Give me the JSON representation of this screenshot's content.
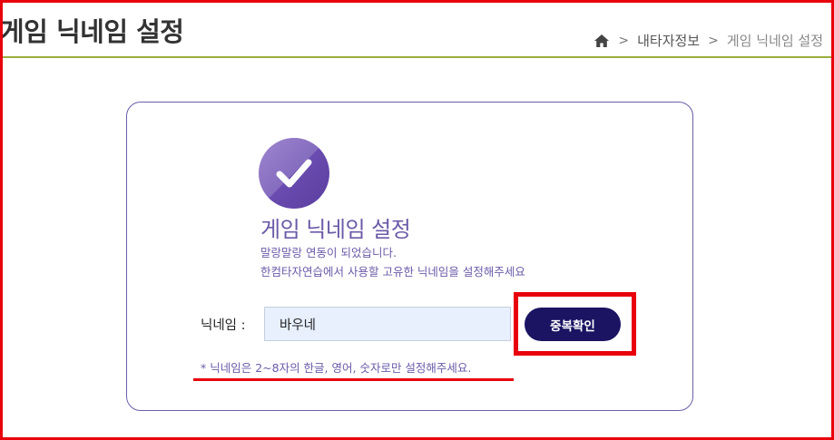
{
  "page": {
    "title": "게임 닉네임 설정"
  },
  "breadcrumb": {
    "home_icon": "home-icon",
    "items": [
      "내타자정보",
      "게임 닉네임 설정"
    ],
    "separator": ">"
  },
  "card": {
    "icon": "check-circle-icon",
    "title": "게임 닉네임 설정",
    "description_line1": "말랑말랑 연동이 되었습니다.",
    "description_line2": "한컴타자연습에서 사용할 고유한 닉네임을 설정해주세요"
  },
  "form": {
    "nickname_label": "닉네임 :",
    "nickname_value": "바우네",
    "check_button_label": "중복확인",
    "hint": "* 닉네임은 2~8자의 한글, 영어, 숫자로만 설정해주세요."
  },
  "colors": {
    "accent_purple": "#6b5aa8",
    "button_navy": "#1a1463",
    "annotation_red": "#e8000b",
    "title_rule": "#9aae3c",
    "input_bg": "#e8f0fe"
  }
}
